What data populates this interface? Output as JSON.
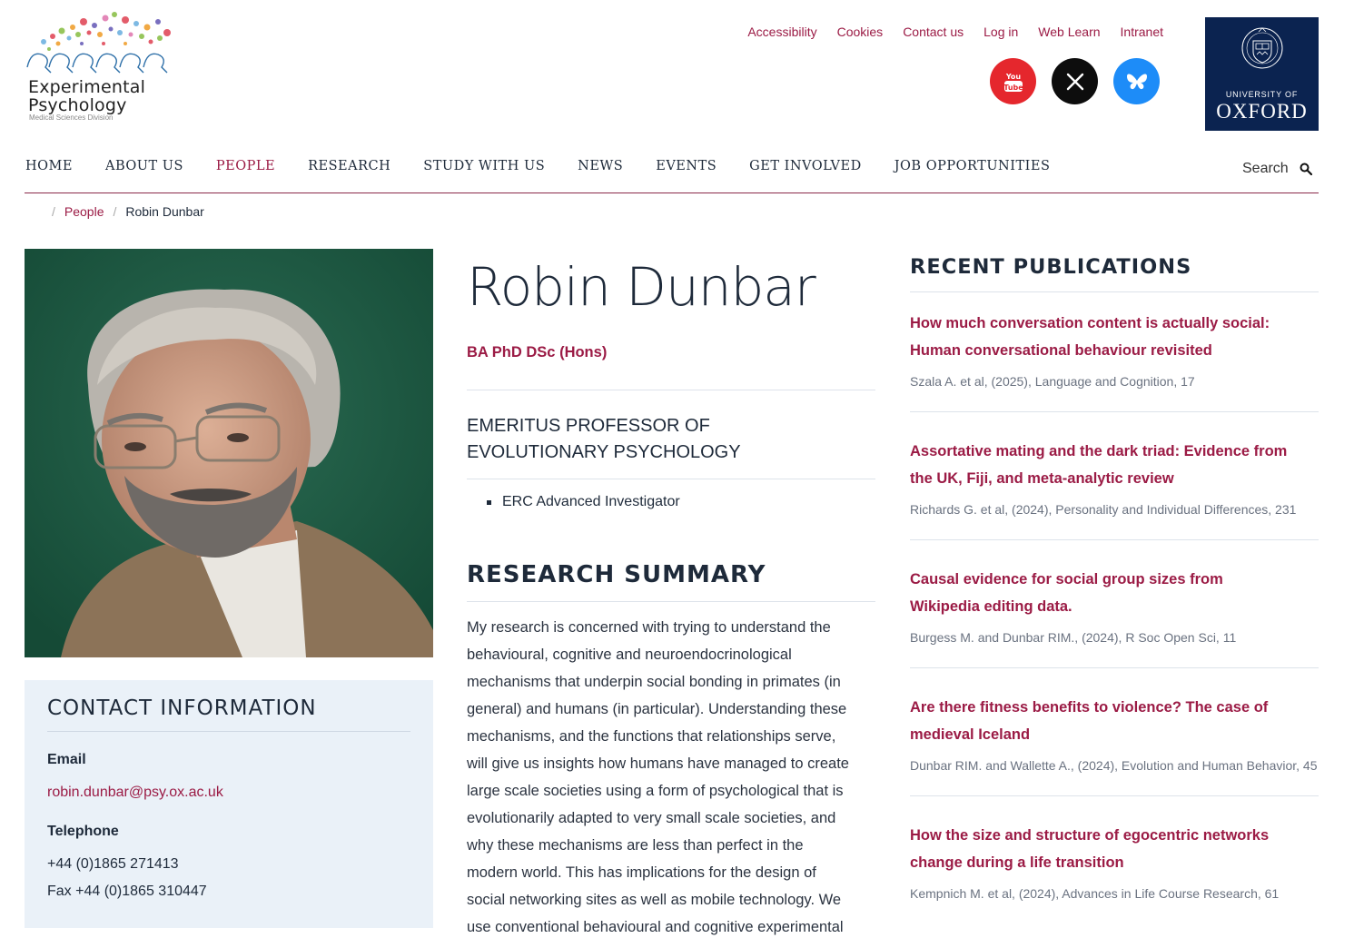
{
  "logo": {
    "line1": "Experimental",
    "line2": "Psychology",
    "sub": "Medical Sciences Division"
  },
  "utility_links": [
    "Accessibility",
    "Cookies",
    "Contact us",
    "Log in",
    "Web Learn",
    "Intranet"
  ],
  "oxford": {
    "line1": "UNIVERSITY OF",
    "line2": "OXFORD"
  },
  "nav": {
    "items": [
      "HOME",
      "ABOUT US",
      "PEOPLE",
      "RESEARCH",
      "STUDY WITH US",
      "NEWS",
      "EVENTS",
      "GET INVOLVED",
      "JOB OPPORTUNITIES"
    ],
    "active": "PEOPLE",
    "search_label": "Search"
  },
  "breadcrumb": {
    "parent": "People",
    "current": "Robin Dunbar"
  },
  "profile": {
    "name": "Robin Dunbar",
    "qualifications": "BA PhD DSc (Hons)",
    "role_line1": "EMERITUS PROFESSOR OF",
    "role_line2": "EVOLUTIONARY PSYCHOLOGY",
    "bullet": "ERC Advanced Investigator"
  },
  "research_summary": {
    "title": "RESEARCH SUMMARY",
    "lines": [
      "My research is concerned with trying to understand the",
      "behavioural, cognitive and neuroendocrinological",
      "mechanisms that underpin social bonding in primates (in",
      "general) and humans (in particular). Understanding these",
      "mechanisms, and the functions that relationships serve,",
      "will give us insights how humans have managed to create",
      "large scale societies using a form of psychological that is",
      "evolutionarily adapted to very small scale societies, and",
      "why these mechanisms are less than perfect in the",
      "modern world. This has implications for the design of",
      "social networking sites as well as mobile technology. We",
      "use conventional behavioural and cognitive experimental"
    ]
  },
  "contact": {
    "title": "CONTACT INFORMATION",
    "email_label": "Email",
    "email": "robin.dunbar@psy.ox.ac.uk",
    "telephone_label": "Telephone",
    "telephone": "+44 (0)1865 271413",
    "fax": "Fax +44 (0)1865 310447"
  },
  "publications": {
    "title": "RECENT PUBLICATIONS",
    "items": [
      {
        "line1": "How much conversation content is actually social:",
        "line2": "Human conversational behaviour revisited",
        "meta": "Szala A. et al, (2025), Language and Cognition, 17"
      },
      {
        "line1": "Assortative mating and the dark triad: Evidence from",
        "line2": "the UK, Fiji, and meta-analytic review",
        "meta": "Richards G. et al, (2024), Personality and Individual Differences, 231"
      },
      {
        "line1": "Causal evidence for social group sizes from",
        "line2": "Wikipedia editing data.",
        "meta": "Burgess M. and Dunbar RIM., (2024), R Soc Open Sci, 11"
      },
      {
        "line1": "Are there fitness benefits to violence? The case of",
        "line2": "medieval Iceland",
        "meta": "Dunbar RIM. and Wallette A., (2024), Evolution and Human Behavior, 45"
      },
      {
        "line1": "How the size and structure of egocentric networks",
        "line2": "change during a life transition",
        "meta": "Kempnich M. et al, (2024), Advances in Life Course Research, 61"
      }
    ]
  },
  "icons": [
    "youtube-icon",
    "x-icon",
    "bluesky-icon",
    "search-icon",
    "oxford-crest-icon"
  ],
  "colors": {
    "accent": "#9b1b45",
    "navy": "#0b2350",
    "text": "#1e2a3a",
    "contact_bg": "#eaf1f8"
  }
}
